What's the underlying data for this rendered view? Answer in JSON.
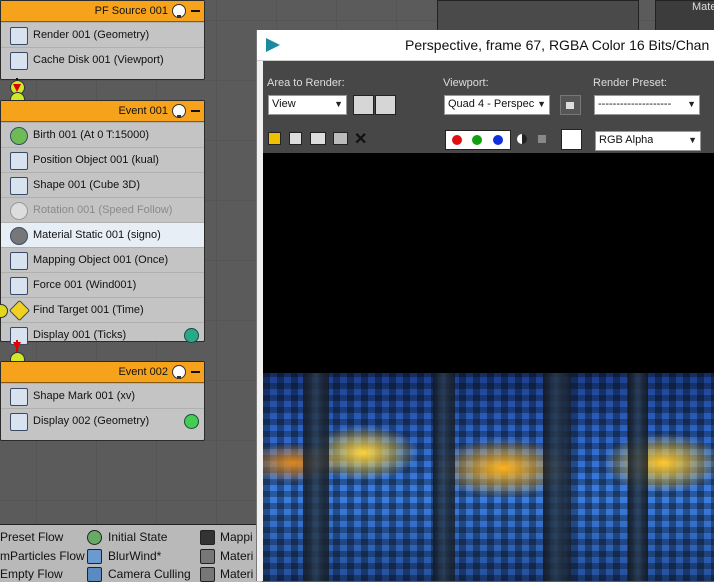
{
  "flow": {
    "source": {
      "title": "PF Source 001",
      "operators": [
        {
          "label": "Render 001 (Geometry)",
          "icon": "render-op-icon"
        },
        {
          "label": "Cache Disk 001 (Viewport)",
          "icon": "cache-disk-icon"
        }
      ]
    },
    "event1": {
      "title": "Event 001",
      "operators": [
        {
          "label": "Birth 001 (At 0 T:15000)",
          "icon": "birth-icon"
        },
        {
          "label": "Position Object 001 (kual)",
          "icon": "position-object-icon"
        },
        {
          "label": "Shape 001 (Cube 3D)",
          "icon": "shape-icon"
        },
        {
          "label": "Rotation 001 (Speed Follow)",
          "icon": "rotation-icon"
        },
        {
          "label": "Material Static 001 (signo)",
          "icon": "material-static-icon"
        },
        {
          "label": "Mapping Object 001 (Once)",
          "icon": "mapping-object-icon"
        },
        {
          "label": "Force 001 (Wind001)",
          "icon": "force-icon"
        },
        {
          "label": "Find Target 001 (Time)",
          "icon": "find-target-icon"
        },
        {
          "label": "Display 001 (Ticks)",
          "icon": "display-icon",
          "color": "#2aa88a"
        }
      ]
    },
    "event2": {
      "title": "Event 002",
      "operators": [
        {
          "label": "Shape Mark 001 (xv)",
          "icon": "shape-mark-icon"
        },
        {
          "label": "Display 002 (Geometry)",
          "icon": "display-icon",
          "color": "#44cc55"
        }
      ]
    }
  },
  "depot": {
    "col1": [
      "Preset Flow",
      "mParticles Flow",
      "Empty Flow"
    ],
    "col2": [
      "Initial State",
      "BlurWind*",
      "Camera Culling"
    ],
    "col3": [
      "Mappi",
      "Materi",
      "Materi"
    ]
  },
  "render_window": {
    "title": "Perspective, frame 67, RGBA Color 16 Bits/Chan",
    "area_label": "Area to Render:",
    "area_value": "View",
    "viewport_label": "Viewport:",
    "viewport_value": "Quad 4 - Perspec",
    "preset_label": "Render Preset:",
    "preset_value": "--------------------",
    "channel_value": "RGB Alpha",
    "colors": {
      "red": "#e01010",
      "green": "#10a010",
      "blue": "#1030e0"
    }
  },
  "background_panel": {
    "label": "Mate"
  }
}
